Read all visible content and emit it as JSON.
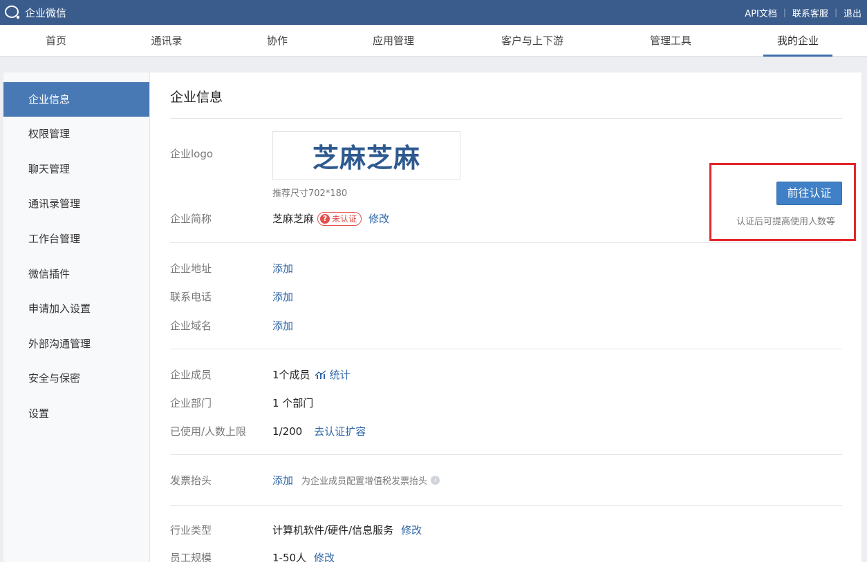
{
  "app": {
    "brand": "企业微信"
  },
  "toplinks": [
    "API文档",
    "联系客服",
    "退出"
  ],
  "nav": [
    "首页",
    "通讯录",
    "协作",
    "应用管理",
    "客户与上下游",
    "管理工具",
    "我的企业"
  ],
  "sidebar": [
    "企业信息",
    "权限管理",
    "聊天管理",
    "通讯录管理",
    "工作台管理",
    "微信插件",
    "申请加入设置",
    "外部沟通管理",
    "安全与保密",
    "设置"
  ],
  "content": {
    "title": "企业信息",
    "logo": {
      "label": "企业logo",
      "text": "芝麻芝麻",
      "hint": "推荐尺寸702*180"
    },
    "short_name": {
      "label": "企业简称",
      "value": "芝麻芝麻",
      "badge": "未认证",
      "edit": "修改"
    },
    "address": {
      "label": "企业地址",
      "action": "添加"
    },
    "phone": {
      "label": "联系电话",
      "action": "添加"
    },
    "domain": {
      "label": "企业域名",
      "action": "添加"
    },
    "members": {
      "label": "企业成员",
      "value": "1个成员",
      "stats": "统计"
    },
    "departments": {
      "label": "企业部门",
      "value": "1 个部门"
    },
    "usage": {
      "label": "已使用/人数上限",
      "value": "1/200",
      "action": "去认证扩容"
    },
    "invoice": {
      "label": "发票抬头",
      "action": "添加",
      "note": "为企业成员配置增值税发票抬头"
    },
    "industry": {
      "label": "行业类型",
      "value": "计算机软件/硬件/信息服务",
      "edit": "修改"
    },
    "staff_size": {
      "label": "员工规模",
      "value": "1-50人",
      "edit": "修改"
    }
  },
  "verify": {
    "button": "前往认证",
    "note": "认证后可提高使用人数等"
  },
  "colors": {
    "topbar": "#3a5c8c",
    "accent": "#4979b4",
    "link": "#2f66a8",
    "alert": "#e3262b"
  }
}
